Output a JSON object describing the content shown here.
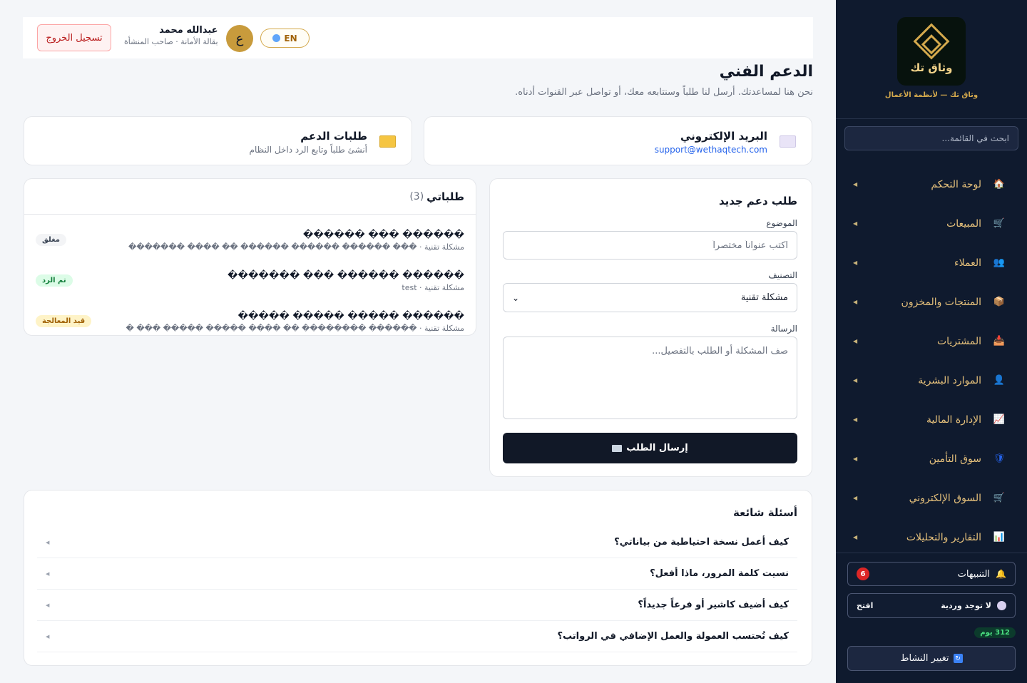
{
  "sidebar": {
    "logo_text": "وثاق تك",
    "tagline": "وثاق تك — لأنظمة الأعمال",
    "search_placeholder": "ابحث في القائمة...",
    "items": [
      {
        "label": "لوحة التحكم",
        "icon": "house-icon",
        "glyph": "🏠",
        "color": "#f97316"
      },
      {
        "label": "المبيعات",
        "icon": "cart-icon",
        "glyph": "🛒",
        "color": "#94a3b8"
      },
      {
        "label": "العملاء",
        "icon": "users-icon",
        "glyph": "👥",
        "color": "#6366f1"
      },
      {
        "label": "المنتجات والمخزون",
        "icon": "box-icon",
        "glyph": "📦",
        "color": "#b45309"
      },
      {
        "label": "المشتريات",
        "icon": "inbox-icon",
        "glyph": "📥",
        "color": "#3b82f6"
      },
      {
        "label": "الموارد البشرية",
        "icon": "person-icon",
        "glyph": "👤",
        "color": "#f59e0b"
      },
      {
        "label": "الإدارة المالية",
        "icon": "chart-up-icon",
        "glyph": "📈",
        "color": "#e2e8f0"
      },
      {
        "label": "سوق التأمين",
        "icon": "shield-icon",
        "glyph": "🛡",
        "color": "#2563eb"
      },
      {
        "label": "السوق الإلكتروني",
        "icon": "cart-icon",
        "glyph": "🛒",
        "color": "#94a3b8"
      },
      {
        "label": "التقارير والتحليلات",
        "icon": "bar-chart-icon",
        "glyph": "📊",
        "color": "#e2e8f0"
      }
    ],
    "notifications_label": "التنبيهات",
    "notifications_count": "6",
    "shift_label": "لا توجد وردية",
    "shift_action": "افتح",
    "days_badge": "312 يوم",
    "switch_label": "تغيير النشاط"
  },
  "topbar": {
    "logout_label": "تسجيل الخروج",
    "user_name": "عبدالله محمد",
    "user_role": "بقالة الأمانة · صاحب المنشأة",
    "avatar_letter": "ع",
    "lang_label": "EN"
  },
  "page": {
    "title": "الدعم الفني",
    "subtitle": "نحن هنا لمساعدتك. أرسل لنا طلباً وسنتابعه معك، أو تواصل عبر القنوات أدناه."
  },
  "channels": {
    "email_title": "البريد الإلكتروني",
    "email_address": "support@wethaqtech.com",
    "tickets_title": "طلبات الدعم",
    "tickets_sub": "أنشئ طلباً وتابع الرد داخل النظام"
  },
  "form": {
    "title": "طلب دعم جديد",
    "subject_label": "الموضوع",
    "subject_placeholder": "اكتب عنواناً مختصراً",
    "category_label": "التصنيف",
    "category_value": "مشكلة تقنية",
    "message_label": "الرسالة",
    "message_placeholder": "صف المشكلة أو الطلب بالتفصيل...",
    "submit_label": "إرسال الطلب"
  },
  "tickets": {
    "title": "طلباتي",
    "count": "(3)",
    "rows": [
      {
        "title": "������ ��� ������",
        "meta": "مشكلة تقنية · ��� ������ ������ ������ �� ���� �������",
        "status": "مغلق",
        "status_class": "st-closed"
      },
      {
        "title": "������ ������ ��� �������",
        "meta": "مشكلة تقنية · test",
        "status": "تم الرد",
        "status_class": "st-replied"
      },
      {
        "title": "������ ����� ����� �����",
        "meta": "مشكلة تقنية · ������ �������� �� ���� ����� ����� ��� �",
        "status": "قيد المعالجة",
        "status_class": "st-progress"
      }
    ]
  },
  "faq": {
    "title": "أسئلة شائعة",
    "items": [
      "كيف أعمل نسخة احتياطية من بياناتي؟",
      "نسيت كلمة المرور، ماذا أفعل؟",
      "كيف أضيف كاشير أو فرعاً جديداً؟",
      "كيف تُحتسب العمولة والعمل الإضافي في الرواتب؟"
    ]
  }
}
